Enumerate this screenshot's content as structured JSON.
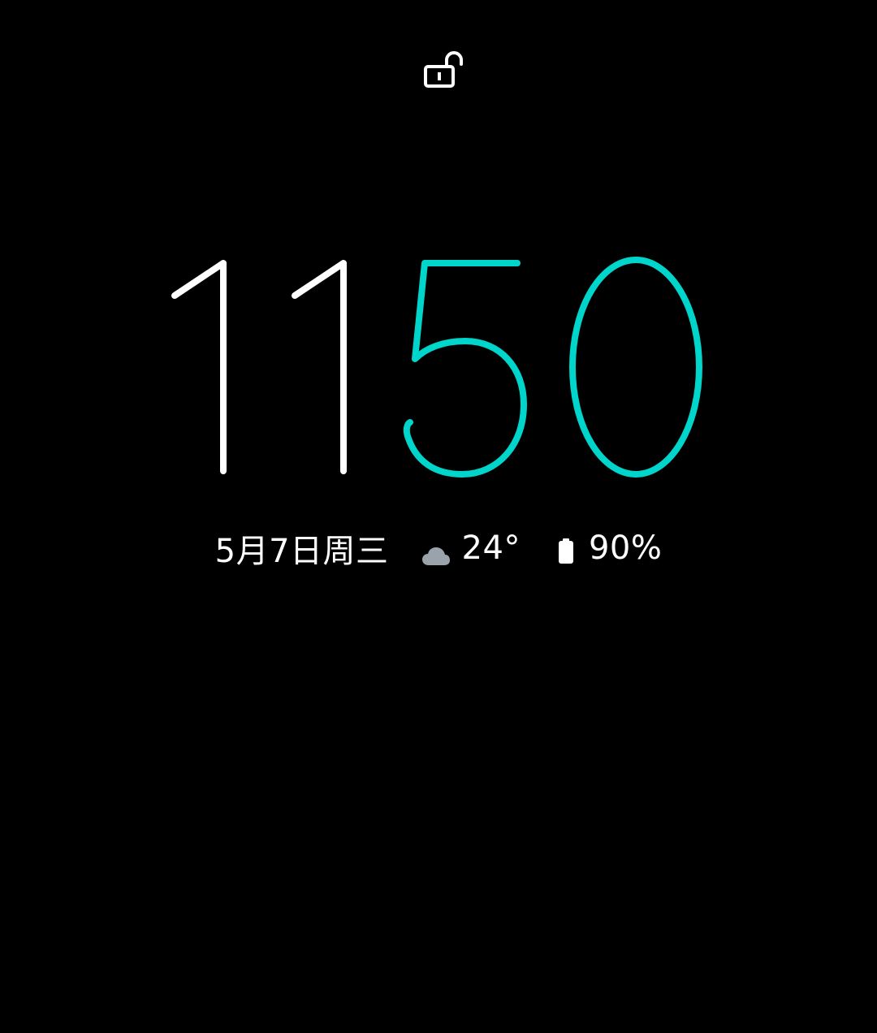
{
  "lockscreen": {
    "clock": {
      "hour_digits": "11",
      "minute_digits": "50",
      "hour_color": "#FFFFFF",
      "minute_color": "#00D5CC"
    },
    "date_text": "5月7日周三",
    "weather": {
      "icon": "cloud-icon",
      "temperature": "24°",
      "icon_color": "#9AA3AC"
    },
    "battery": {
      "icon": "battery-icon",
      "level_text": "90%",
      "level": 0.9
    },
    "lock_icon": "unlocked-padlock-icon"
  }
}
